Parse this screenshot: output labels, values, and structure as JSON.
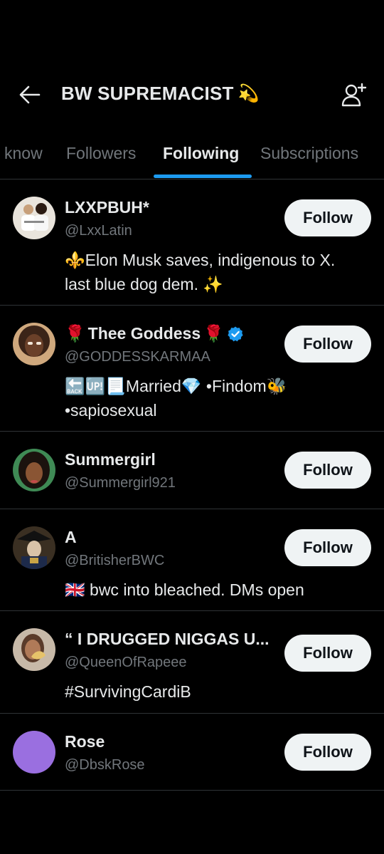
{
  "header": {
    "title": "BW SUPREMACIST",
    "title_emoji": "💫",
    "back_icon": "arrow-left-icon",
    "add_user_icon": "add-user-icon"
  },
  "tabs": [
    {
      "label": "know",
      "active": false
    },
    {
      "label": "Followers",
      "active": false
    },
    {
      "label": "Following",
      "active": true
    },
    {
      "label": "Subscriptions",
      "active": false
    }
  ],
  "accent_color": "#1d9bf0",
  "users": [
    {
      "name": "LXXPBUH*",
      "handle": "@LxxLatin",
      "bio_1": "⚜️Elon Musk saves, indigenous to X.",
      "bio_2": "last blue dog dem. ✨",
      "follow_label": "Follow",
      "verified": false
    },
    {
      "name_prefix": "🌹",
      "name": "Thee Goddess",
      "name_suffix": "🌹",
      "handle": "@GODDESSKARMAA",
      "bio_1": "🔙🆙📃Married💎 •Findom🐝",
      "bio_2": "•sapiosexual",
      "follow_label": "Follow",
      "verified": true
    },
    {
      "name": "Summergirl",
      "handle": "@Summergirl921",
      "follow_label": "Follow",
      "verified": false
    },
    {
      "name": "A",
      "handle": "@BritisherBWC",
      "bio_1": "🇬🇧 bwc into bleached. DMs open",
      "follow_label": "Follow",
      "verified": false
    },
    {
      "name": "“ I DRUGGED NIGGAS U...",
      "handle": "@QueenOfRapeee",
      "bio_1": "#SurvivingCardiB",
      "follow_label": "Follow",
      "verified": false
    },
    {
      "name": "Rose",
      "handle": "@DbskRose",
      "follow_label": "Follow",
      "verified": false,
      "avatar_color": "#9a6fe0"
    }
  ]
}
